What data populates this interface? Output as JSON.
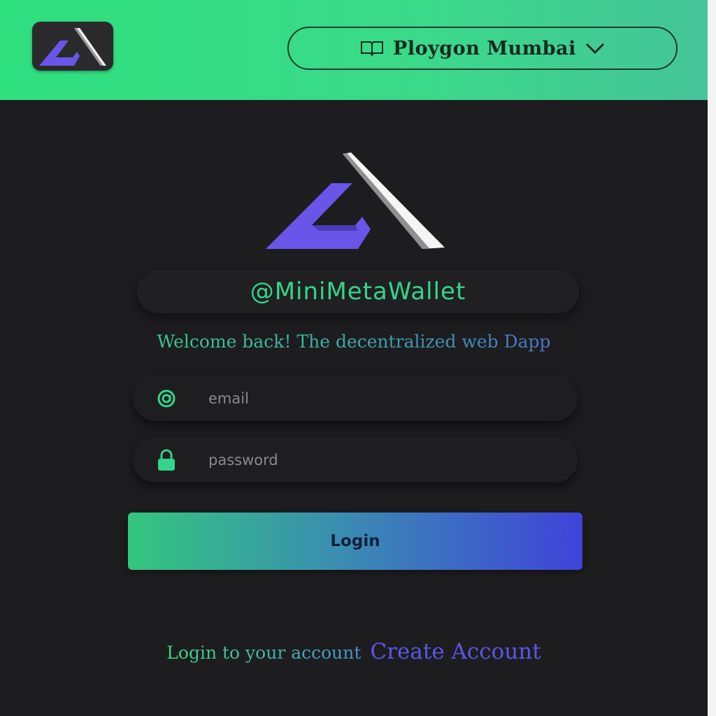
{
  "header": {
    "network": {
      "label": "Ploygon Mumbai",
      "icon": "book-icon",
      "chevron_icon": "chevron-down-icon"
    }
  },
  "brand": {
    "handle": "@MiniMetaWallet",
    "welcome": "Welcome back! The decentralized web Dapp"
  },
  "form": {
    "email_placeholder": "email",
    "password_placeholder": "password",
    "email_icon": "at-icon",
    "password_icon": "lock-icon",
    "login_label": "Login"
  },
  "footer": {
    "prompt": "Login to your account",
    "create_label": "Create Account"
  },
  "colors": {
    "header_green": "#2fe07f",
    "accent_green": "#34d58a",
    "accent_purple": "#5b56e8",
    "background": "#1d1d1f"
  }
}
